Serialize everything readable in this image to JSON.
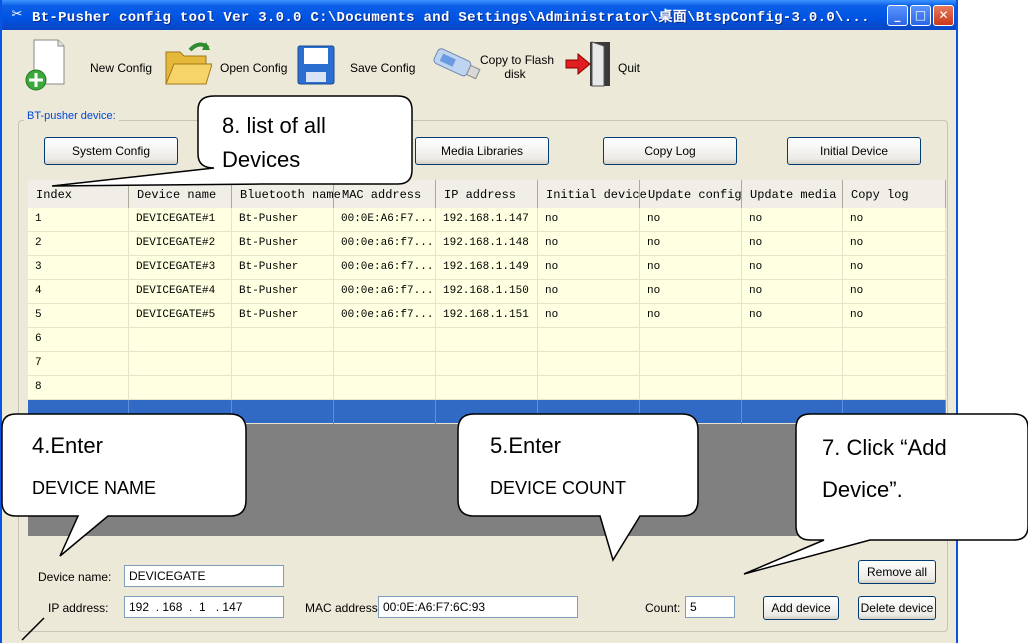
{
  "window": {
    "title": "Bt-Pusher config tool Ver 3.0.0    C:\\Documents and Settings\\Administrator\\桌面\\BtspConfig-3.0.0\\...",
    "minimize_glyph": "_",
    "maximize_glyph": "□",
    "close_glyph": "✕"
  },
  "toolbar": {
    "new_config": "New Config",
    "open_config": "Open Config",
    "save_config": "Save Config",
    "copy_flash_line1": "Copy to Flash",
    "copy_flash_line2": "disk",
    "quit": "Quit"
  },
  "group": {
    "title": "BT-pusher device:",
    "buttons": {
      "system_config": "System Config",
      "media_libraries": "Media Libraries",
      "copy_log": "Copy Log",
      "initial_device": "Initial Device"
    }
  },
  "table": {
    "columns": [
      "Index",
      "Device name",
      "Bluetooth name",
      "MAC address",
      "IP address",
      "Initial device",
      "Update config",
      "Update media",
      "Copy log"
    ],
    "rows": [
      [
        "1",
        "DEVICEGATE#1",
        "Bt-Pusher",
        "00:0E:A6:F7...",
        "192.168.1.147",
        "no",
        "no",
        "no",
        "no"
      ],
      [
        "2",
        "DEVICEGATE#2",
        "Bt-Pusher",
        "00:0e:a6:f7...",
        "192.168.1.148",
        "no",
        "no",
        "no",
        "no"
      ],
      [
        "3",
        "DEVICEGATE#3",
        "Bt-Pusher",
        "00:0e:a6:f7...",
        "192.168.1.149",
        "no",
        "no",
        "no",
        "no"
      ],
      [
        "4",
        "DEVICEGATE#4",
        "Bt-Pusher",
        "00:0e:a6:f7...",
        "192.168.1.150",
        "no",
        "no",
        "no",
        "no"
      ],
      [
        "5",
        "DEVICEGATE#5",
        "Bt-Pusher",
        "00:0e:a6:f7...",
        "192.168.1.151",
        "no",
        "no",
        "no",
        "no"
      ],
      [
        "6",
        "",
        "",
        "",
        "",
        "",
        "",
        "",
        ""
      ],
      [
        "7",
        "",
        "",
        "",
        "",
        "",
        "",
        "",
        ""
      ],
      [
        "8",
        "",
        "",
        "",
        "",
        "",
        "",
        "",
        ""
      ],
      [
        "",
        "",
        "",
        "",
        "",
        "",
        "",
        "",
        ""
      ]
    ]
  },
  "form": {
    "device_name_label": "Device name:",
    "device_name_value": "DEVICEGATE",
    "ip_label": "IP address:",
    "ip_value": "192  . 168  .  1   . 147",
    "mac_label": "MAC address:",
    "mac_value": "00:0E:A6:F7:6C:93",
    "count_label": "Count:",
    "count_value": "5",
    "remove_all": "Remove all",
    "add_device": "Add device",
    "delete_device": "Delete device"
  },
  "callouts": {
    "c8_line1": "8. list of all",
    "c8_line2": "Devices",
    "c4_line1": "4.Enter",
    "c4_line2": "DEVICE NAME",
    "c5_line1": "5.Enter",
    "c5_line2": "DEVICE COUNT",
    "c7_line1": "7. Click “Add",
    "c7_line2": "Device”."
  },
  "colors": {
    "titlebar": "#0054E3",
    "window_bg": "#ECE9D8",
    "row_bg": "#FFFFE1",
    "selected_row": "#316AC5",
    "empty_area": "#808080"
  }
}
